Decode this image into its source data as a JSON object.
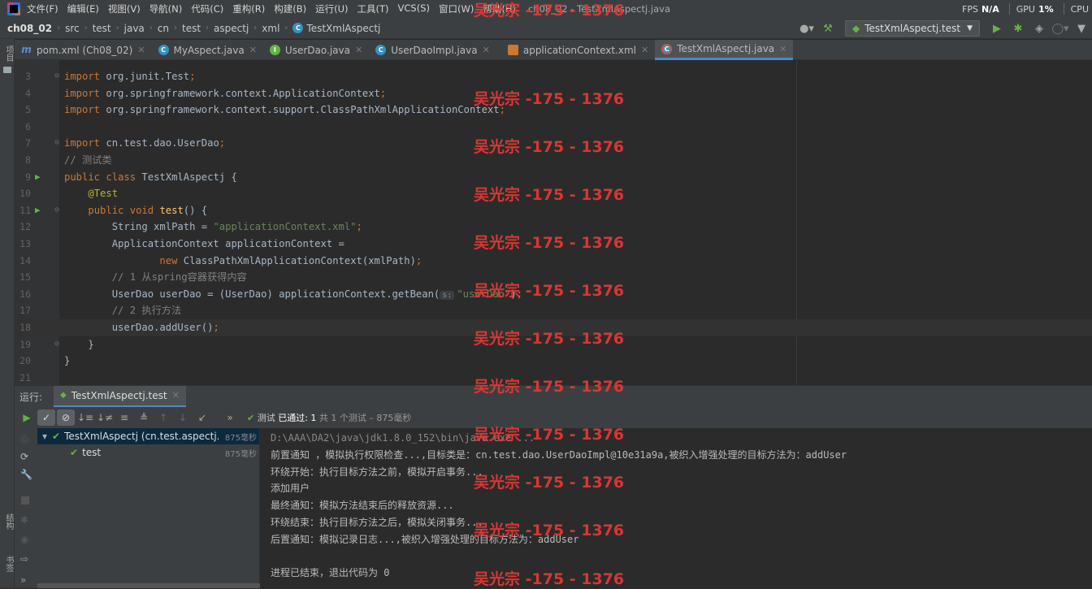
{
  "menu": [
    "文件(F)",
    "编辑(E)",
    "视图(V)",
    "导航(N)",
    "代码(C)",
    "重构(R)",
    "构建(B)",
    "运行(U)",
    "工具(T)",
    "VCS(S)",
    "窗口(W)",
    "帮助(H)"
  ],
  "window_title": "ch08_02 - TestXmlAspectj.java",
  "stats": {
    "fps_label": "FPS",
    "fps_value": "N/A",
    "gpu_label": "GPU",
    "gpu_value": "1%",
    "cpu_label": "CPU"
  },
  "breadcrumb": {
    "project": "ch08_02",
    "parts": [
      "src",
      "test",
      "java",
      "cn",
      "test",
      "aspectj",
      "xml"
    ],
    "file": "TestXmlAspectj"
  },
  "run_config": "TestXmlAspectj.test",
  "side_labels": {
    "project": "项目",
    "structure": "结构",
    "bookmarks": "书签"
  },
  "tabs": [
    {
      "label": "pom.xml (Ch08_02)",
      "icon": "maven-icon",
      "kind": "m"
    },
    {
      "label": "MyAspect.java",
      "icon": "class-icon",
      "kind": "c"
    },
    {
      "label": "UserDao.java",
      "icon": "interface-icon",
      "kind": "i"
    },
    {
      "label": "UserDaoImpl.java",
      "icon": "class-icon",
      "kind": "c"
    },
    {
      "label": "applicationContext.xml",
      "icon": "xml-icon",
      "kind": "x"
    },
    {
      "label": "TestXmlAspectj.java",
      "icon": "test-class-icon",
      "kind": "t",
      "active": true
    }
  ],
  "code_lines": [
    {
      "n": "3",
      "text": "import org.junit.Test;"
    },
    {
      "n": "4",
      "text": "import org.springframework.context.ApplicationContext;"
    },
    {
      "n": "5",
      "text": "import org.springframework.context.support.ClassPathXmlApplicationContext;"
    },
    {
      "n": "6",
      "text": ""
    },
    {
      "n": "7",
      "text": "import cn.test.dao.UserDao;"
    },
    {
      "n": "8",
      "text": "// 测试类"
    },
    {
      "n": "9",
      "text": "public class TestXmlAspectj {"
    },
    {
      "n": "10",
      "text": "    @Test"
    },
    {
      "n": "11",
      "text": "    public void test() {"
    },
    {
      "n": "12",
      "text": "        String xmlPath = \"applicationContext.xml\";"
    },
    {
      "n": "13",
      "text": "        ApplicationContext applicationContext ="
    },
    {
      "n": "14",
      "text": "                new ClassPathXmlApplicationContext(xmlPath);"
    },
    {
      "n": "15",
      "text": "        // 1 从spring容器获得内容"
    },
    {
      "n": "16",
      "text": "        UserDao userDao = (UserDao) applicationContext.getBean( s: \"userDao\");"
    },
    {
      "n": "17",
      "text": "        // 2 执行方法"
    },
    {
      "n": "18",
      "text": "        userDao.addUser();"
    },
    {
      "n": "19",
      "text": "    }"
    },
    {
      "n": "20",
      "text": "}"
    },
    {
      "n": "21",
      "text": ""
    }
  ],
  "run": {
    "label": "运行:",
    "tab": "TestXmlAspectj.test",
    "status_prefix": "测试",
    "status_passed": "已通过: 1",
    "status_detail": "共 1 个测试 – 875毫秒",
    "tree": [
      {
        "label": "TestXmlAspectj (cn.test.aspectj.xm",
        "time": "875毫秒"
      },
      {
        "label": "test",
        "time": "875毫秒"
      }
    ],
    "console": [
      "D:\\AAA\\DA2\\java\\jdk1.8.0_152\\bin\\java.exe ...",
      "前置通知 ，模拟执行权限检查...,目标类是：cn.test.dao.UserDaoImpl@10e31a9a,被织入增强处理的目标方法为：addUser",
      "环绕开始：执行目标方法之前，模拟开启事务...",
      "添加用户",
      "最终通知：模拟方法结束后的释放资源...",
      "环绕结束：执行目标方法之后，模拟关闭事务...",
      "后置通知：模拟记录日志...,被织入增强处理的目标方法为：addUser",
      "",
      "进程已结束，退出代码为 0"
    ]
  },
  "watermark": "吴光宗 -175 - 1376",
  "colors": {
    "accent": "#4a88c7",
    "pass": "#62b543",
    "watermark": "#e53935"
  }
}
